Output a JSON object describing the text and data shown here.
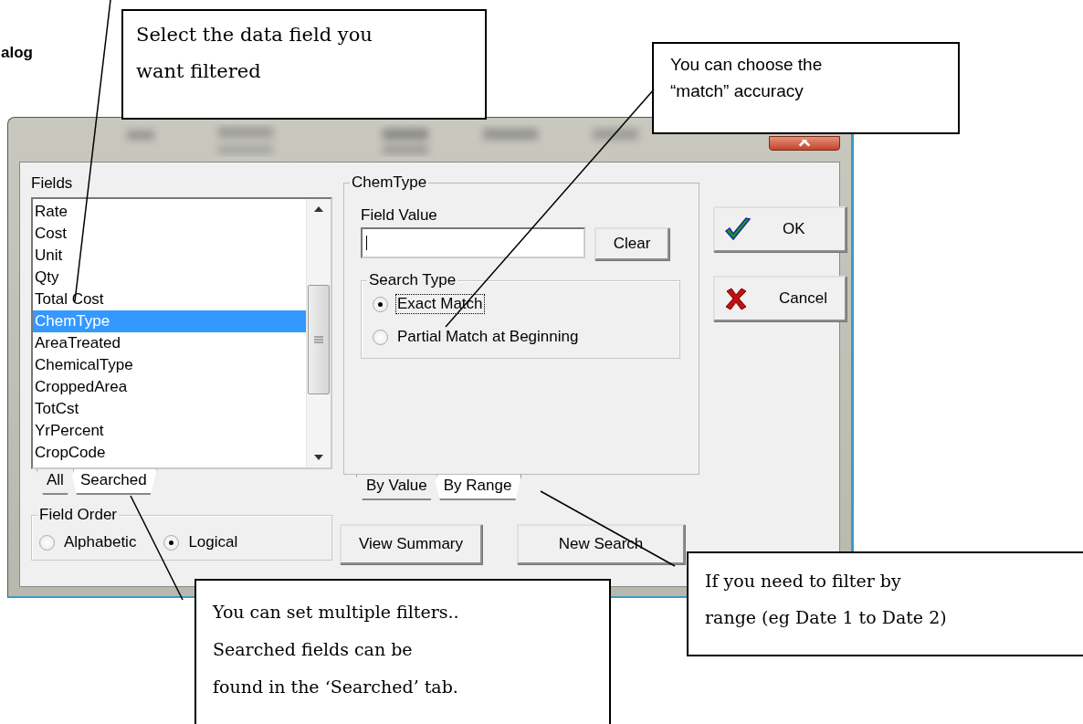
{
  "heading": "alog",
  "dialog": {
    "fields_label": "Fields",
    "fields": [
      {
        "label": "Rate",
        "selected": false
      },
      {
        "label": "Cost",
        "selected": false
      },
      {
        "label": "Unit",
        "selected": false
      },
      {
        "label": "Qty",
        "selected": false
      },
      {
        "label": "Total Cost",
        "selected": false
      },
      {
        "label": "ChemType",
        "selected": true
      },
      {
        "label": "AreaTreated",
        "selected": false
      },
      {
        "label": "ChemicalType",
        "selected": false
      },
      {
        "label": "CroppedArea",
        "selected": false
      },
      {
        "label": "TotCst",
        "selected": false
      },
      {
        "label": "YrPercent",
        "selected": false
      },
      {
        "label": "CropCode",
        "selected": false
      }
    ],
    "list_tabs": [
      {
        "label": "All",
        "selected": true
      },
      {
        "label": "Searched",
        "selected": false
      }
    ],
    "field_order": {
      "title": "Field Order",
      "options": [
        {
          "label": "Alphabetic",
          "selected": false
        },
        {
          "label": "Logical",
          "selected": true
        }
      ]
    },
    "value_group": {
      "title": "ChemType",
      "field_label": "Field Value",
      "clear_button": "Clear",
      "search_type": {
        "title": "Search Type",
        "options": [
          {
            "label": "Exact Match",
            "selected": true
          },
          {
            "label": "Partial Match at Beginning",
            "selected": false
          }
        ]
      }
    },
    "mode_tabs": [
      {
        "label": "By Value",
        "selected": true
      },
      {
        "label": "By Range",
        "selected": false
      }
    ],
    "buttons": [
      {
        "label": "OK",
        "kind": "ok"
      },
      {
        "label": "Cancel",
        "kind": "cancel"
      }
    ],
    "bottom_buttons": [
      "View Summary",
      "New Search"
    ]
  },
  "callouts": [
    {
      "lines": [
        "Select the data field you",
        "want filtered"
      ]
    },
    {
      "lines": [
        "You can choose the",
        "“match” accuracy"
      ]
    },
    {
      "lines": [
        "You can set multiple filters..",
        "Searched fields can be",
        "found in the ‘Searched’ tab."
      ]
    },
    {
      "lines": [
        "If you need to filter by",
        "range (eg Date 1 to Date 2)"
      ]
    }
  ]
}
